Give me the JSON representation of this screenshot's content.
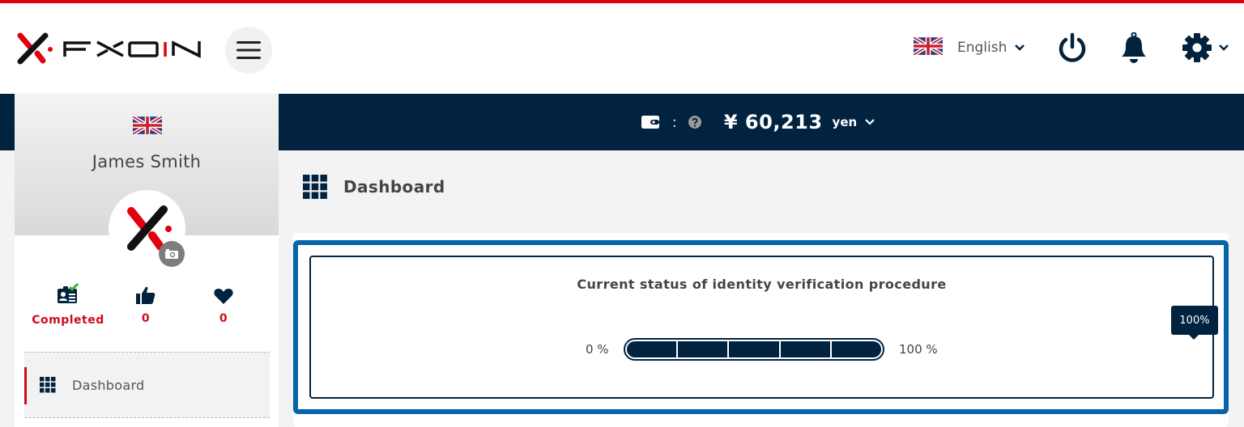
{
  "app": {
    "brand": "FXON",
    "accent_color": "#e0000f",
    "navy_color": "#01233f",
    "frame_color": "#0465a8"
  },
  "header": {
    "menu_icon": "hamburger-icon",
    "language": {
      "flag": "uk-flag-icon",
      "label": "English",
      "chevron": "chevron-down-icon"
    },
    "icons": [
      "power-icon",
      "bell-icon",
      "gear-icon"
    ]
  },
  "balance": {
    "wallet_icon": "wallet-icon",
    "separator": ":",
    "help_icon": "question-circle-icon",
    "amount": "¥ 60,213",
    "unit": "yen"
  },
  "sidebar": {
    "profile": {
      "flag": "uk-flag-icon",
      "name": "James Smith"
    },
    "stats": [
      {
        "icon": "id-card-check-icon",
        "value": "Completed"
      },
      {
        "icon": "thumbs-up-icon",
        "value": "0"
      },
      {
        "icon": "heart-icon",
        "value": "0"
      }
    ],
    "nav": [
      {
        "icon": "grid-icon",
        "label": "Dashboard",
        "active": true
      }
    ]
  },
  "main": {
    "page_title": "Dashboard",
    "verification": {
      "title": "Current status of identity verification procedure",
      "min_label": "0 %",
      "max_label": "100 %",
      "progress_percent": 100,
      "tooltip": "100%",
      "segments": 5
    }
  }
}
